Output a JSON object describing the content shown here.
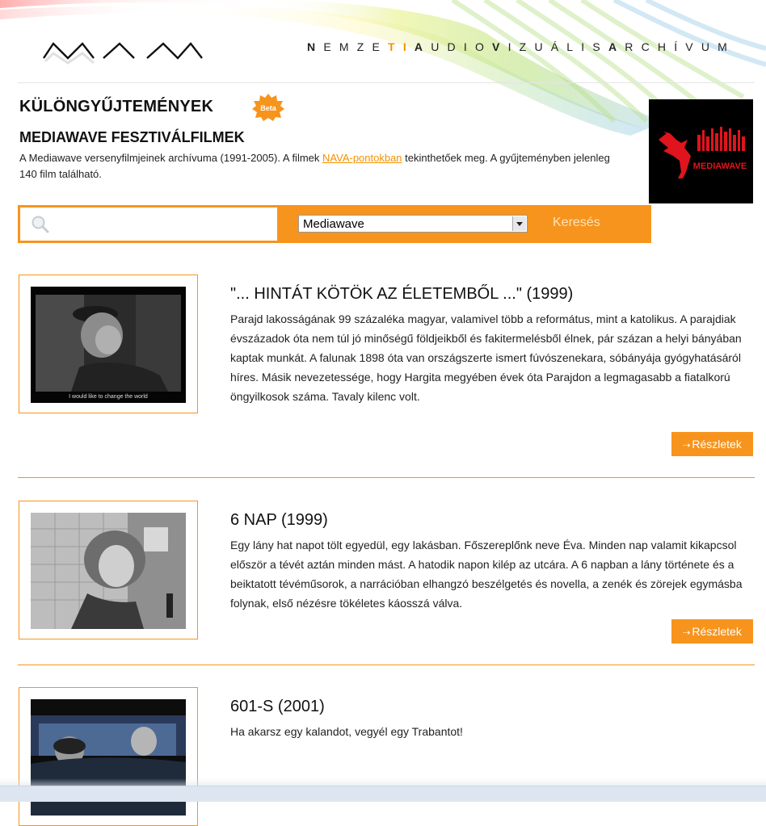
{
  "header": {
    "brand": [
      {
        "t": "N",
        "w": "b"
      },
      {
        "t": "E",
        "w": "l"
      },
      {
        "t": "M",
        "w": "l"
      },
      {
        "t": "Z",
        "w": "l"
      },
      {
        "t": "E",
        "w": "l"
      },
      {
        "t": "T",
        "w": "bo"
      },
      {
        "t": "I",
        "w": "bo"
      },
      {
        "t": "A",
        "w": "b"
      },
      {
        "t": "U",
        "w": "l"
      },
      {
        "t": "D",
        "w": "l"
      },
      {
        "t": "I",
        "w": "l"
      },
      {
        "t": "O",
        "w": "l"
      },
      {
        "t": "V",
        "w": "b"
      },
      {
        "t": "I",
        "w": "l"
      },
      {
        "t": "Z",
        "w": "l"
      },
      {
        "t": "U",
        "w": "l"
      },
      {
        "t": "Á",
        "w": "l"
      },
      {
        "t": "L",
        "w": "l"
      },
      {
        "t": "I",
        "w": "l"
      },
      {
        "t": "S",
        "w": "l"
      },
      {
        "t": "A",
        "w": "b"
      },
      {
        "t": "R",
        "w": "l"
      },
      {
        "t": "C",
        "w": "l"
      },
      {
        "t": "H",
        "w": "l"
      },
      {
        "t": "Í",
        "w": "l"
      },
      {
        "t": "V",
        "w": "l"
      },
      {
        "t": "U",
        "w": "l"
      },
      {
        "t": "M",
        "w": "l"
      }
    ]
  },
  "collection": {
    "heading": "KÜLÖNGYŰJTEMÉNYEK",
    "beta": "Beta",
    "subheading": "MEDIAWAVE FESZTIVÁLFILMEK",
    "intro_before": "A Mediawave versenyfilmjeinek archívuma (1991-2005). A filmek ",
    "intro_link": "NAVA-pontokban",
    "intro_after": " tekinthetőek meg. A gyűjteményben jelenleg 140 film található.",
    "logo_text": "MEDIAWAVE"
  },
  "search": {
    "value": "",
    "placeholder": "",
    "select_value": "Mediawave",
    "button": "Keresés"
  },
  "films": [
    {
      "title": "\"... HINTÁT KÖTÖK AZ ÉLETEMBŐL ...\" (1999)",
      "subtitle_in_still": "I would like to change the world",
      "description": "Parajd lakosságának 99 százaléka magyar, valamivel több a református, mint a katolikus. A parajdiak évszázadok óta nem túl jó minőségű földjeikből és fakitermelésből élnek, pár százan a helyi bányában kaptak munkát. A falunak 1898 óta van országszerte ismert fúvószenekara, sóbányája gyógyhatásáról híres. Másik nevezetessége, hogy Hargita megyében évek óta Parajdon a legmagasabb a fiatalkorú öngyilkosok száma. Tavaly kilenc volt.",
      "details": "Részletek"
    },
    {
      "title": "6 NAP (1999)",
      "description": "Egy lány hat napot tölt egyedül, egy lakásban. Főszereplőnk neve Éva. Minden nap valamit kikapcsol először a tévét aztán minden mást. A hatodik napon kilép az utcára. A 6 napban a lány története és a beiktatott tévéműsorok, a narrációban elhangzó beszélgetés és novella, a zenék és zörejek egymásba folynak, első nézésre tökéletes káosszá válva.",
      "details": "Részletek"
    },
    {
      "title": "601-S (2001)",
      "description": "Ha akarsz egy kalandot, vegyél egy Trabantot!"
    }
  ]
}
